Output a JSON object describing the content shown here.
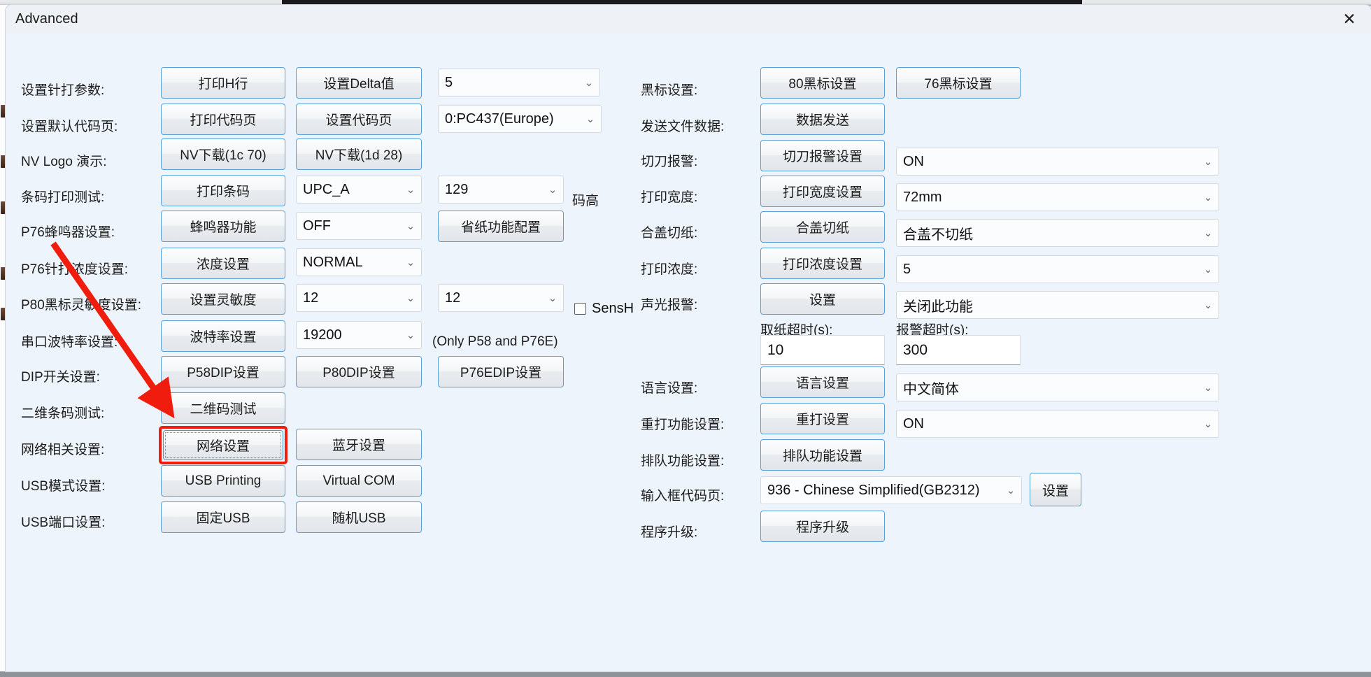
{
  "window": {
    "title": "Advanced",
    "close_icon": "close-icon"
  },
  "annotation": {
    "color": "#f01d0e",
    "target": "网络设置"
  },
  "left_column": {
    "rows": [
      {
        "label": "设置针打参数:",
        "btn1": "打印H行",
        "btn2": "设置Delta值",
        "combo1": "5"
      },
      {
        "label": "设置默认代码页:",
        "btn1": "打印代码页",
        "btn2": "设置代码页",
        "combo1": "0:PC437(Europe)"
      },
      {
        "label": "NV Logo 演示:",
        "btn1": "NV下载(1c 70)",
        "btn2": "NV下载(1d 28)"
      },
      {
        "label": "条码打印测试:",
        "btn1": "打印条码",
        "combo1": "UPC_A",
        "combo2": "129",
        "suffix": "码高"
      },
      {
        "label": "P76蜂鸣器设置:",
        "btn1": "蜂鸣器功能",
        "combo1": "OFF",
        "btn3": "省纸功能配置"
      },
      {
        "label": "P76针打浓度设置:",
        "btn1": "浓度设置",
        "combo1": "NORMAL"
      },
      {
        "label": "P80黑标灵敏度设置:",
        "btn1": "设置灵敏度",
        "combo1": "12",
        "combo2": "12",
        "checkbox": "SensH"
      },
      {
        "label": "串口波特率设置:",
        "btn1": "波特率设置",
        "combo1": "19200",
        "suffix": "(Only P58 and P76E)"
      },
      {
        "label": "DIP开关设置:",
        "btn1": "P58DIP设置",
        "btn2": "P80DIP设置",
        "btn3": "P76EDIP设置"
      },
      {
        "label": "二维条码测试:",
        "btn1": "二维码测试"
      },
      {
        "label": "网络相关设置:",
        "btn1": "网络设置",
        "btn2": "蓝牙设置"
      },
      {
        "label": "USB模式设置:",
        "btn1": "USB Printing",
        "btn2": "Virtual COM"
      },
      {
        "label": "USB端口设置:",
        "btn1": "固定USB",
        "btn2": "随机USB"
      }
    ]
  },
  "right_column": {
    "rows": [
      {
        "label": "黑标设置:",
        "btn1": "80黑标设置",
        "btn2": "76黑标设置"
      },
      {
        "label": "发送文件数据:",
        "btn1": "数据发送"
      },
      {
        "label": "切刀报警:",
        "btn1": "切刀报警设置",
        "combo1": "ON"
      },
      {
        "label": "打印宽度:",
        "btn1": "打印宽度设置",
        "combo1": "72mm"
      },
      {
        "label": "合盖切纸:",
        "btn1": "合盖切纸",
        "combo1": "合盖不切纸"
      },
      {
        "label": "打印浓度:",
        "btn1": "打印浓度设置",
        "combo1": "5"
      },
      {
        "label": "声光报警:",
        "btn1": "设置",
        "combo1": "关闭此功能"
      },
      {
        "label": "语言设置:",
        "btn1": "语言设置",
        "combo1": "中文简体"
      },
      {
        "label": "重打功能设置:",
        "btn1": "重打设置",
        "combo1": "ON"
      },
      {
        "label": "排队功能设置:",
        "btn1": "排队功能设置"
      },
      {
        "label": "输入框代码页:",
        "combo1": "936 - Chinese Simplified(GB2312)",
        "btn2": "设置"
      },
      {
        "label": "程序升级:",
        "btn1": "程序升级"
      }
    ],
    "timeouts": {
      "paper_label": "取纸超时(s):",
      "paper_value": "10",
      "alarm_label": "报警超时(s):",
      "alarm_value": "300"
    }
  }
}
